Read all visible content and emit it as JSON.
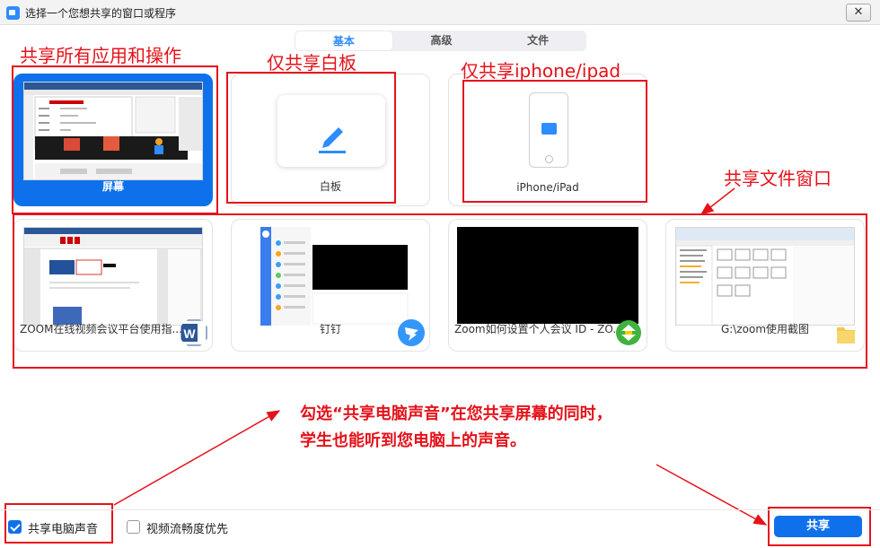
{
  "window": {
    "title": "选择一个您想共享的窗口或程序",
    "close_symbol": "✕"
  },
  "tabs": [
    {
      "label": "基本",
      "active": true
    },
    {
      "label": "高级",
      "active": false
    },
    {
      "label": "文件",
      "active": false
    }
  ],
  "cards_top": [
    {
      "label": "屏幕",
      "selected": true
    },
    {
      "label": "白板",
      "selected": false
    },
    {
      "label": "iPhone/iPad",
      "selected": false
    }
  ],
  "cards_windows": [
    {
      "label": "ZOOM在线视频会议平台使用指...",
      "app_icon": "word-icon"
    },
    {
      "label": "钉钉",
      "app_icon": "dingtalk-icon"
    },
    {
      "label": "Zoom如何设置个人会议 ID - ZO...",
      "app_icon": "browser-icon"
    },
    {
      "label": "G:\\zoom使用截图",
      "app_icon": "folder-icon"
    }
  ],
  "annotations": {
    "screen": "共享所有应用和操作",
    "whiteboard": "仅共享白板",
    "iphone": "仅共享iphone/ipad",
    "windows": "共享文件窗口",
    "audio_line1": "勾选“共享电脑声音”在您共享屏幕的同时，",
    "audio_line2": "学生也能听到您电脑上的声音。"
  },
  "bottom": {
    "share_audio": {
      "label": "共享电脑声音",
      "checked": true
    },
    "video_optimize": {
      "label": "视频流畅度优先",
      "checked": false
    },
    "share_button": "共享"
  },
  "colors": {
    "accent": "#0e71eb",
    "annotation": "#e5121a"
  }
}
